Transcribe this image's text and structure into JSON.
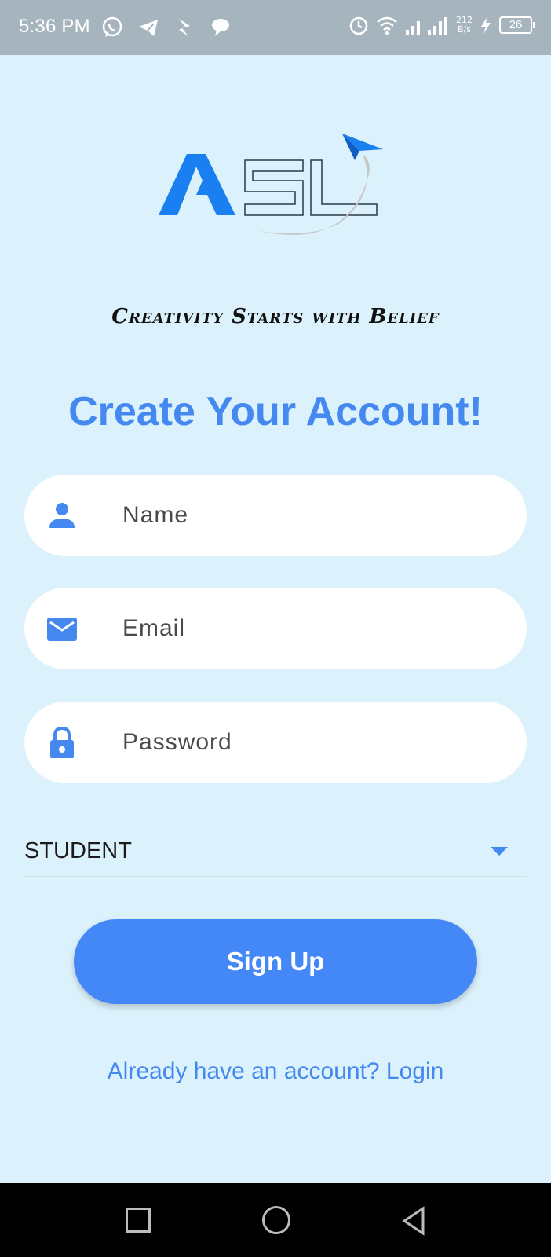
{
  "status_bar": {
    "time": "5:36 PM",
    "left_icons": [
      "whatsapp-icon",
      "telegram-icon",
      "bolt-app-icon",
      "chat-bubble-icon"
    ],
    "net_speed_value": "212",
    "net_speed_unit": "B/s",
    "battery": "26",
    "right_icons": [
      "alarm-icon",
      "wifi-icon",
      "signal-icon",
      "charging-icon"
    ]
  },
  "logo": {
    "text": "ASL",
    "colors": {
      "accent": "#1a7ff0",
      "outline": "#2b3a4a",
      "swoosh": "#c8c8c8"
    }
  },
  "tagline": "Creativity Starts with Belief",
  "heading": "Create Your Account!",
  "form": {
    "name": {
      "placeholder": "Name",
      "icon": "person-icon"
    },
    "email": {
      "placeholder": "Email",
      "icon": "mail-icon"
    },
    "password": {
      "placeholder": "Password",
      "icon": "lock-icon"
    },
    "role": {
      "selected": "STUDENT"
    }
  },
  "signup_label": "Sign Up",
  "login_link": "Already have an account? Login",
  "colors": {
    "accent": "#4488f0",
    "background": "#dbf1fc",
    "button": "#4488f8"
  }
}
